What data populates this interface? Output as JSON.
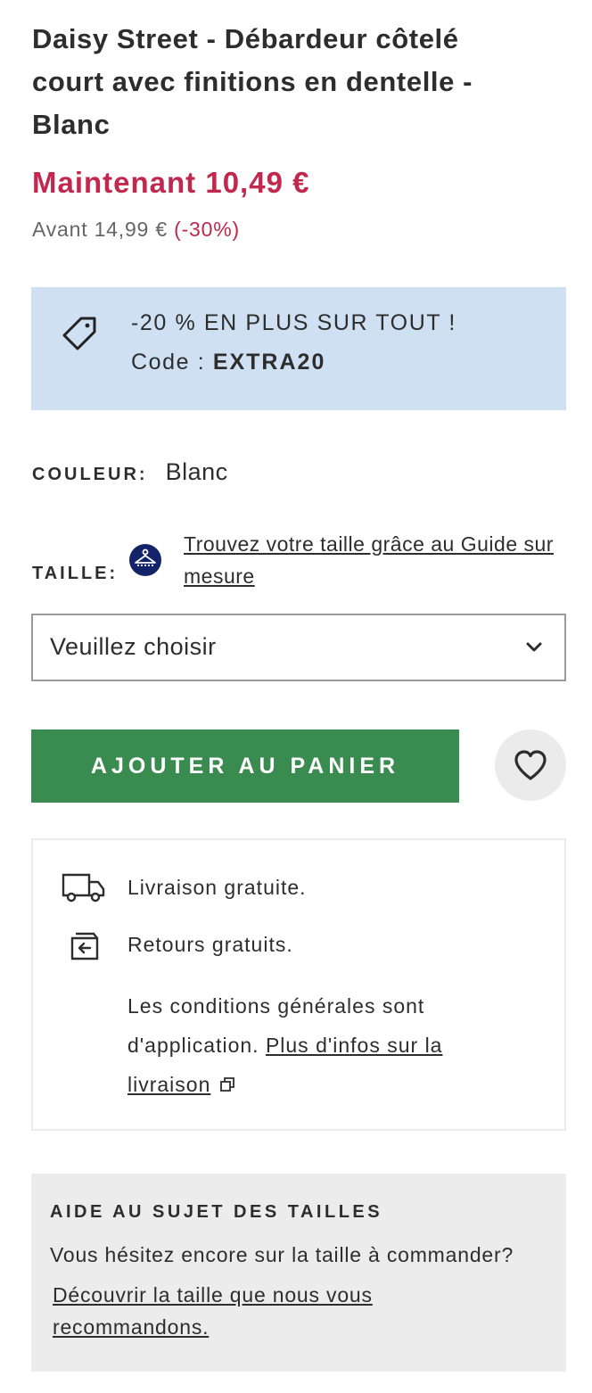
{
  "product": {
    "title": "Daisy Street - Débardeur côtelé court avec finitions en dentelle - Blanc",
    "price_now": "Maintenant 10,49 €",
    "price_was": "Avant 14,99 €",
    "discount": "(-30%)"
  },
  "promo": {
    "icon": "tag-icon",
    "line1": "-20 % EN PLUS SUR TOUT !",
    "code_label": "Code :",
    "code": "EXTRA20"
  },
  "colour": {
    "label": "COULEUR:",
    "value": "Blanc"
  },
  "size": {
    "label": "TAILLE:",
    "guide_icon": "hanger-icon",
    "guide_link": "Trouvez votre taille grâce au Guide sur mesure",
    "select_value": "Veuillez choisir"
  },
  "actions": {
    "add_to_cart": "AJOUTER AU PANIER",
    "wishlist_icon": "heart-icon",
    "accent": "#3a8b50"
  },
  "delivery": {
    "free_delivery": "Livraison gratuite.",
    "free_returns": "Retours gratuits.",
    "conditions": "Les conditions générales sont d'application.",
    "more_link": "Plus d'infos sur la livraison"
  },
  "help": {
    "heading": "AIDE AU SUJET DES TAILLES",
    "text": "Vous hésitez encore sur la taille à commander?",
    "link": "Découvrir la taille que nous vous recommandons."
  },
  "colors": {
    "sale": "#c1284d",
    "promo_bg": "#cfe0f3",
    "help_bg": "#ececec"
  }
}
